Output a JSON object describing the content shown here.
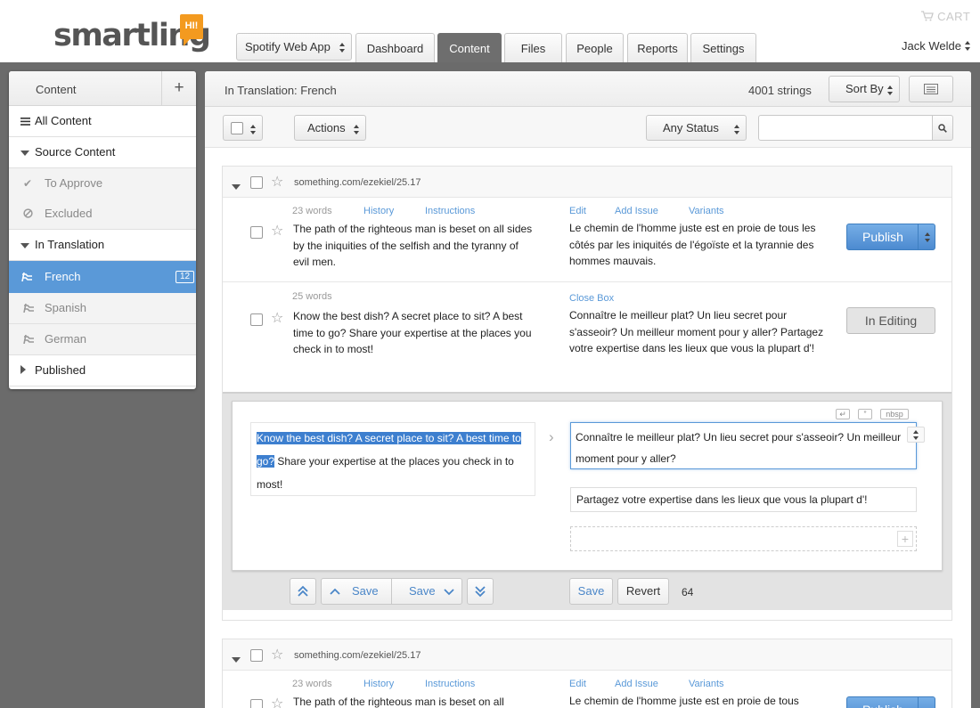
{
  "header": {
    "logo_text": "smartling",
    "logo_badge": "HI!",
    "project": "Spotify Web App",
    "tabs": [
      {
        "label": "Dashboard"
      },
      {
        "label": "Content"
      },
      {
        "label": "Files"
      },
      {
        "label": "People"
      },
      {
        "label": "Reports"
      },
      {
        "label": "Settings"
      }
    ],
    "active_tab": "Content",
    "cart": "CART",
    "user": "Jack Welde"
  },
  "sidebar": {
    "title": "Content",
    "add": "+",
    "items": [
      {
        "label": "All Content",
        "icon": "list-icon"
      },
      {
        "label": "Source Content",
        "icon": "triangle-down-icon"
      },
      {
        "label": "To Approve",
        "icon": "check-icon"
      },
      {
        "label": "Excluded",
        "icon": "ban-icon"
      },
      {
        "label": "In Translation",
        "icon": "triangle-down-icon"
      },
      {
        "label": "French",
        "icon": "flag-icon",
        "count": "12"
      },
      {
        "label": "Spanish",
        "icon": "flag-icon"
      },
      {
        "label": "German",
        "icon": "flag-icon"
      },
      {
        "label": "Published",
        "icon": "triangle-right-icon"
      }
    ]
  },
  "main": {
    "title": "In Translation: French",
    "string_count": "4001 strings",
    "sort_by": "Sort By",
    "actions": "Actions",
    "status_filter": "Any Status",
    "search_placeholder": "",
    "cards": [
      {
        "url": "something.com/ezekiel/25.17",
        "rows": [
          {
            "words": "23 words",
            "history": "History",
            "instructions": "Instructions",
            "edit": "Edit",
            "add_issue": "Add Issue",
            "variants": "Variants",
            "source": "The path of the righteous man is beset on all sides by the iniquities of the selfish and the tyranny of evil men.",
            "target": "Le chemin de l'homme juste est en proie de tous les côtés par les iniquités de l'égoïste et la tyrannie des hommes mauvais.",
            "action": "Publish"
          },
          {
            "words": "25 words",
            "close_box": "Close Box",
            "source": "Know the best dish? A secret place to sit? A best time to go? Share your expertise at the places you check in to most!",
            "target": "Connaître le meilleur plat? Un lieu secret pour s'asseoir? Un meilleur moment pour y aller? Partagez votre expertise dans les lieux que vous la plupart d'!",
            "action": "In Editing"
          }
        ],
        "editor": {
          "source_highlight": "Know the best dish? A secret place to sit? A best time to go?",
          "source_rest": " Share your expertise at the places you check in to most!",
          "target_1": "Connaître le meilleur plat? Un lieu secret pour s'asseoir? Un meilleur moment pour y aller?",
          "target_2": "Partagez votre expertise dans les lieux que vous la plupart d'!",
          "icon_return": "↵",
          "icon_quote": "”",
          "icon_nbsp": "nbsp",
          "save_up": "Save",
          "save_down": "Save",
          "save": "Save",
          "revert": "Revert",
          "char_count": "64"
        }
      },
      {
        "url": "something.com/ezekiel/25.17",
        "rows": [
          {
            "words": "23 words",
            "history": "History",
            "instructions": "Instructions",
            "edit": "Edit",
            "add_issue": "Add Issue",
            "variants": "Variants",
            "source": "The path of the righteous man is beset on all",
            "target": "Le chemin de l'homme juste est en proie de tous",
            "action": "Publish"
          }
        ]
      }
    ]
  },
  "colors": {
    "accent": "#5a99d8",
    "brand_orange": "#f39a1f",
    "active_tab": "#6e6e6e",
    "background": "#6b6b6b"
  }
}
